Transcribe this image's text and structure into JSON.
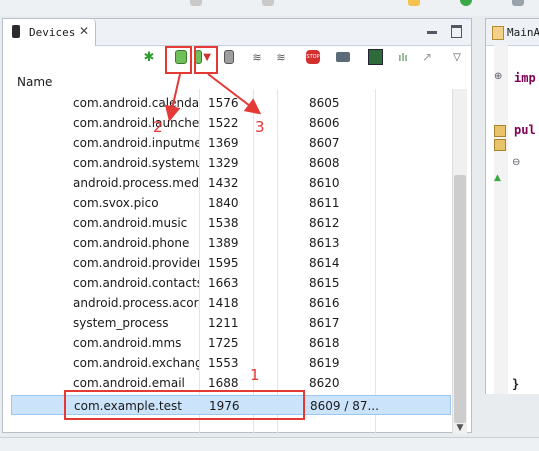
{
  "panel": {
    "tab_label": "Devices",
    "tab_close": "✕",
    "column_name": "Name"
  },
  "rows": [
    {
      "name": "com.android.calendar",
      "pid": "1576",
      "port": "8605"
    },
    {
      "name": "com.android.launcher",
      "pid": "1522",
      "port": "8606"
    },
    {
      "name": "com.android.inputmethod",
      "pid": "1369",
      "port": "8607"
    },
    {
      "name": "com.android.systemui",
      "pid": "1329",
      "port": "8608"
    },
    {
      "name": "android.process.media",
      "pid": "1432",
      "port": "8610"
    },
    {
      "name": "com.svox.pico",
      "pid": "1840",
      "port": "8611"
    },
    {
      "name": "com.android.music",
      "pid": "1538",
      "port": "8612"
    },
    {
      "name": "com.android.phone",
      "pid": "1389",
      "port": "8613"
    },
    {
      "name": "com.android.providers",
      "pid": "1595",
      "port": "8614"
    },
    {
      "name": "com.android.contacts",
      "pid": "1663",
      "port": "8615"
    },
    {
      "name": "android.process.acore",
      "pid": "1418",
      "port": "8616"
    },
    {
      "name": "system_process",
      "pid": "1211",
      "port": "8617"
    },
    {
      "name": "com.android.mms",
      "pid": "1725",
      "port": "8618"
    },
    {
      "name": "com.android.exchange",
      "pid": "1553",
      "port": "8619"
    },
    {
      "name": "com.android.email",
      "pid": "1688",
      "port": "8620"
    },
    {
      "name": "com.example.test",
      "pid": "1976",
      "port": "8609 / 87..."
    }
  ],
  "annotations": {
    "n1": "1",
    "n2": "2",
    "n3": "3"
  },
  "editor": {
    "tab_label": "MainA",
    "line_imp": "imp",
    "line_pub": "pul",
    "brace_close": "}"
  },
  "colors": {
    "annotation": "#e53935",
    "selection": "#cce4fb"
  }
}
